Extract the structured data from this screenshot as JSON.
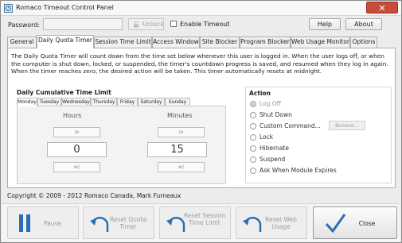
{
  "window": {
    "title": "Romaco Timeout Control Panel",
    "close_glyph": "✕"
  },
  "header": {
    "password_label": "Password:",
    "password_value": "",
    "unlock_label": "Unlock",
    "enable_timeout_label": "Enable Timeout",
    "enable_timeout_checked": false,
    "help_label": "Help",
    "about_label": "About"
  },
  "tabs": [
    {
      "label": "General",
      "active": false
    },
    {
      "label": "Daily Quota Timer",
      "active": true
    },
    {
      "label": "Session Time Limit",
      "active": false
    },
    {
      "label": "Access Window",
      "active": false
    },
    {
      "label": "Site Blocker",
      "active": false
    },
    {
      "label": "Program Blocker",
      "active": false
    },
    {
      "label": "Web Usage Monitor",
      "active": false
    },
    {
      "label": "Options",
      "active": false
    }
  ],
  "panel": {
    "description": "The Daily Quota Timer will count down from the time set below whenever this user is logged in. When the user logs off, or when the computer is shut down, locked, or suspended, the timer's countdown progress is saved, and resumed when they log in again. When the timer reaches zero, the desired action will be taken. This timer automatically resets at midnight.",
    "quota_title": "Daily Cumulative Time Limit",
    "days": [
      {
        "label": "Monday",
        "active": true
      },
      {
        "label": "Tuesday",
        "active": false
      },
      {
        "label": "Wednesday",
        "active": false
      },
      {
        "label": "Thursday",
        "active": false
      },
      {
        "label": "Friday",
        "active": false
      },
      {
        "label": "Saturday",
        "active": false
      },
      {
        "label": "Sunday",
        "active": false
      }
    ],
    "hours_label": "Hours",
    "hours_value": "0",
    "hours_up": "/e",
    "hours_down": "w/",
    "minutes_label": "Minutes",
    "minutes_value": "15",
    "minutes_up": "/e",
    "minutes_down": "w/",
    "action_title": "Action",
    "actions": [
      {
        "label": "Log Off",
        "checked": true,
        "disabled": true
      },
      {
        "label": "Shut Down",
        "checked": false,
        "disabled": false
      },
      {
        "label": "Custom Command...",
        "checked": false,
        "disabled": false
      },
      {
        "label": "Lock",
        "checked": false,
        "disabled": false
      },
      {
        "label": "Hibernate",
        "checked": false,
        "disabled": false
      },
      {
        "label": "Suspend",
        "checked": false,
        "disabled": false
      },
      {
        "label": "Ask When Module Expires",
        "checked": false,
        "disabled": false
      }
    ],
    "browse_label": "Browse..."
  },
  "footer": {
    "copyright": "Copyright © 2009 - 2012 Romaco Canada, Mark Furneaux",
    "pause_label": "Pause",
    "reset_quota_label": "Reset Quota Timer",
    "reset_session_label": "Reset Session Time Limit",
    "reset_web_label": "Reset Web Usage",
    "close_label": "Close"
  },
  "colors": {
    "accent": "#2a6fb5",
    "close_red": "#c84b3c"
  }
}
